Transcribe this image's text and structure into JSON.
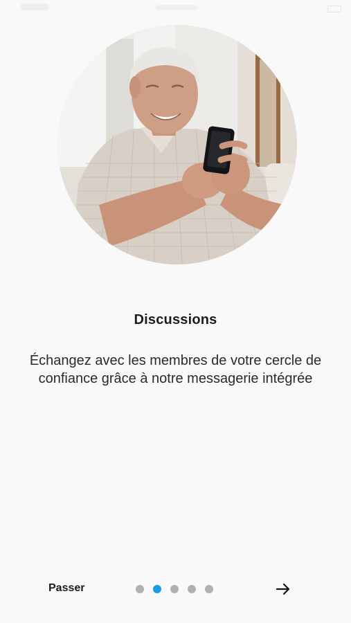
{
  "onboarding": {
    "title": "Discussions",
    "description": "Échangez avec les membres de votre cercle de confiance grâce à notre messagerie intégrée",
    "illustration_icon": "senior-man-using-phone-photo"
  },
  "footer": {
    "skip_label": "Passer",
    "next_icon": "arrow-right-icon",
    "page_count": 5,
    "current_page": 2
  },
  "colors": {
    "background": "#f9f9f9",
    "accent": "#1a9be6",
    "dot_inactive": "#b0b0b0",
    "text": "#1c1c1e"
  }
}
